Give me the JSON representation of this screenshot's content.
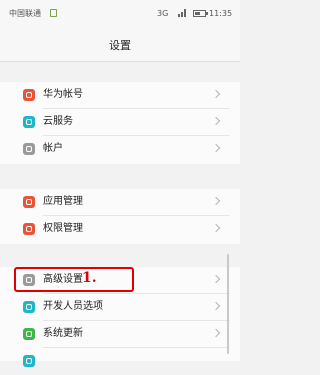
{
  "status_bar": {
    "carrier": "中国联通",
    "network": "3G",
    "time": "11:35"
  },
  "header": {
    "title": "设置"
  },
  "settings": {
    "group1": [
      {
        "label": "华为帐号",
        "icon": "huawei-account-icon",
        "color": "#e8533a"
      },
      {
        "label": "云服务",
        "icon": "cloud-icon",
        "color": "#1fb7c7"
      },
      {
        "label": "帐户",
        "icon": "account-icon",
        "color": "#9a9a9a"
      }
    ],
    "group2": [
      {
        "label": "应用管理",
        "icon": "app-manage-icon",
        "color": "#e8533a"
      },
      {
        "label": "权限管理",
        "icon": "permission-icon",
        "color": "#e8533a"
      }
    ],
    "group3": [
      {
        "label": "高级设置",
        "icon": "advanced-settings-icon",
        "color": "#9a9a9a"
      },
      {
        "label": "开发人员选项",
        "icon": "developer-options-icon",
        "color": "#1fb7c7"
      },
      {
        "label": "系统更新",
        "icon": "system-update-icon",
        "color": "#3fb54a"
      },
      {
        "label": "",
        "icon": "partial-item-icon",
        "color": "#1fb7c7"
      }
    ]
  },
  "annotation": {
    "text": "1."
  }
}
